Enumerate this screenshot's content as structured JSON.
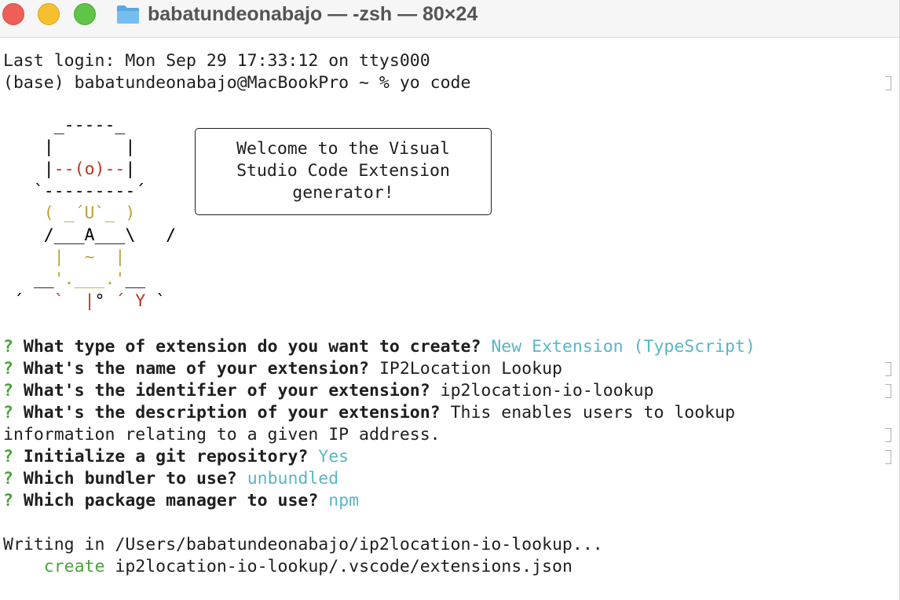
{
  "window": {
    "title": "babatundeonabajo — -zsh — 80×24",
    "folder_icon": "folder-icon"
  },
  "terminal": {
    "last_login": "Last login: Mon Sep 29 17:33:12 on ttys000",
    "prompt": "(base) babatundeonabajo@MacBookPro ~ % yo code",
    "ascii_art": {
      "line1": "     _-----_",
      "line2_a": "    |       |",
      "line3_a": "    |",
      "line3_b": "--(o)--",
      "line3_c": "|",
      "line4": "   `---------´",
      "line5": "    ( _´U`_ )",
      "line6": "    /___A___\\   /",
      "line7_a": "     |",
      "line7_b": "  ~  ",
      "line7_c": "|",
      "line8_a": "   __",
      "line8_b": "'.___.'",
      "line8_c": "__",
      "line9_a": " ´   ",
      "line9_b": "`  |",
      "line9_c": "° ",
      "line9_d": "´ Y",
      "line9_e": " `"
    },
    "welcome": {
      "line1": "Welcome to the Visual",
      "line2": "Studio Code Extension",
      "line3": "generator!"
    },
    "prompts": [
      {
        "mark": "?",
        "question": "What type of extension do you want to create?",
        "answer": "New Extension (TypeScript)"
      },
      {
        "mark": "?",
        "question": "What's the name of your extension?",
        "answer": "IP2Location Lookup"
      },
      {
        "mark": "?",
        "question": "What's the identifier of your extension?",
        "answer": "ip2location-io-lookup"
      },
      {
        "mark": "?",
        "question": "What's the description of your extension?",
        "answer": "This enables users to lookup"
      },
      {
        "mark": "?",
        "question": "Initialize a git repository?",
        "answer": "Yes"
      },
      {
        "mark": "?",
        "question": "Which bundler to use?",
        "answer": "unbundled"
      },
      {
        "mark": "?",
        "question": "Which package manager to use?",
        "answer": "npm"
      }
    ],
    "description_continued": "information relating to a given IP address.",
    "writing": "Writing in /Users/babatundeonabajo/ip2location-io-lookup...",
    "create_label": "create",
    "create_path": "ip2location-io-lookup/.vscode/extensions.json"
  },
  "colors": {
    "prompt_mark": "#4aa33c",
    "answer": "#5ab5c5",
    "create": "#4aa33c",
    "ascii_red": "#b4371f",
    "ascii_olive": "#b6a43a"
  }
}
